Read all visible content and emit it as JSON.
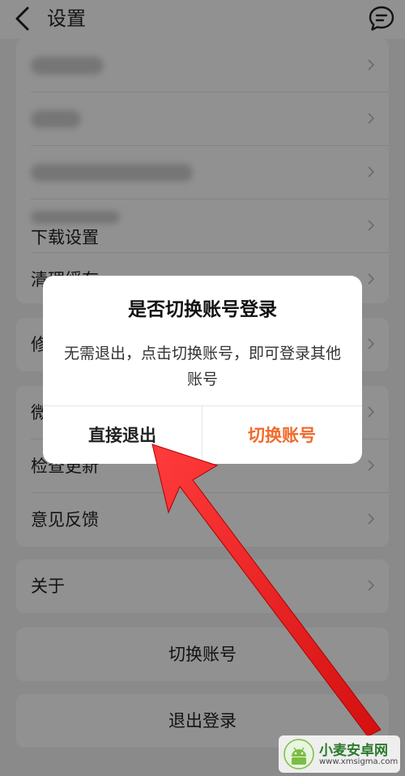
{
  "header": {
    "title": "设置"
  },
  "settings": {
    "partial_row_label": "下载设置",
    "rows": {
      "clear_cache": "清理缓存",
      "modify": "修",
      "wechat": "微",
      "check_update": "检查更新",
      "feedback": "意见反馈",
      "about": "关于"
    }
  },
  "buttons": {
    "switch_account": "切换账号",
    "logout": "退出登录"
  },
  "dialog": {
    "title": "是否切换账号登录",
    "message": "无需退出，点击切换账号，即可登录其他账号",
    "exit_button": "直接退出",
    "switch_button": "切换账号"
  },
  "watermark": {
    "name": "小麦安卓网",
    "url": "www.xmsigma.com"
  },
  "colors": {
    "accent": "#f06a2b",
    "arrow": "#ee1c1c"
  }
}
